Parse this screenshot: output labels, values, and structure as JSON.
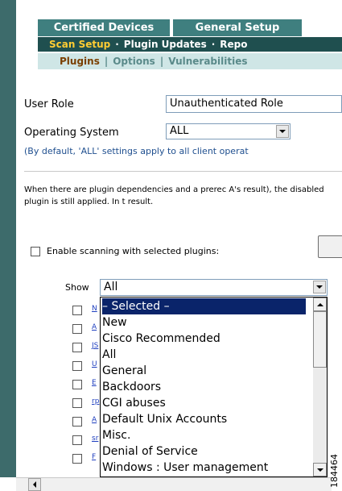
{
  "tabs": [
    {
      "label": "Certified Devices"
    },
    {
      "label": "General Setup"
    }
  ],
  "subnav": {
    "active": "Scan Setup",
    "items": [
      "Plugin Updates",
      "Repo"
    ]
  },
  "subsub": {
    "active": "Plugins",
    "items": [
      "Options",
      "Vulnerabilities"
    ]
  },
  "form": {
    "user_role_label": "User Role",
    "user_role_value": "Unauthenticated Role",
    "os_label": "Operating System",
    "os_value": "ALL",
    "note": "(By default, 'ALL' settings apply to all client operat"
  },
  "description": "When there are plugin dependencies and a prerec A's result), the disabled plugin is still applied. In t result.",
  "enable_label": "Enable scanning with selected plugins:",
  "show": {
    "label": "Show",
    "value": "All",
    "options": [
      "– Selected –",
      "New",
      "Cisco Recommended",
      "All",
      "General",
      "Backdoors",
      "CGI abuses",
      "Default Unix Accounts",
      "Misc.",
      "Denial of Service",
      "Windows : User management"
    ],
    "selected_index": 0
  },
  "row_links": [
    "N",
    "A",
    "JS",
    "U",
    "E",
    "rp",
    "A",
    "sr",
    "F"
  ],
  "figure_id": "184464",
  "colors": {
    "tab_bg": "#3f7f7f",
    "subnav_bg": "#1f4f4f",
    "subnav_active": "#ffcc33",
    "subsub_bg": "#cfe6e6",
    "selection_bg": "#0a246a",
    "leftbar": "#3d6b6b"
  }
}
